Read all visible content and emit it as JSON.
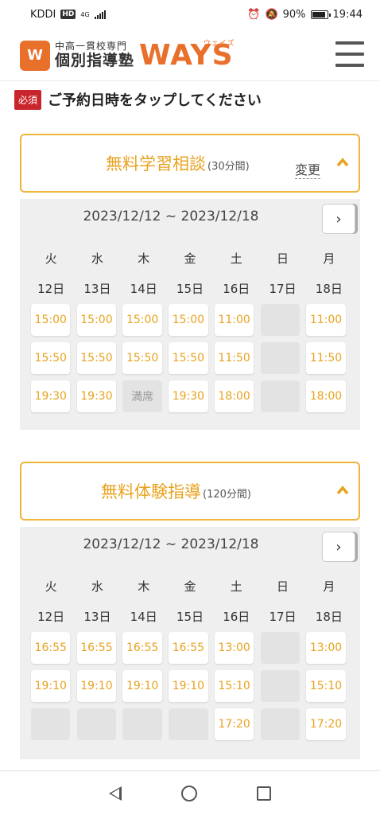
{
  "status": {
    "carrier": "KDDI",
    "hd": "HD",
    "network": "4G",
    "battery": "90%",
    "time": "19:44"
  },
  "header": {
    "logo_mark": "W",
    "logo_sub": "中高一貫校専門",
    "logo_main": "個別指導塾",
    "brand": "WAYS",
    "brand_kana": "ウェイズ"
  },
  "prompt": {
    "required": "必須",
    "text": "ご予約日時をタップしてください"
  },
  "sections": [
    {
      "title": "無料学習相談",
      "duration": "(30分間)",
      "change": "変更",
      "date_range": "2023/12/12 ~ 2023/12/18",
      "next": "›",
      "weekdays": [
        "火",
        "水",
        "木",
        "金",
        "土",
        "日",
        "月"
      ],
      "days": [
        "12日",
        "13日",
        "14日",
        "15日",
        "16日",
        "17日",
        "18日"
      ],
      "slots": [
        [
          "15:00",
          "15:00",
          "15:00",
          "15:00",
          "11:00",
          "",
          "11:00"
        ],
        [
          "15:50",
          "15:50",
          "15:50",
          "15:50",
          "11:50",
          "",
          "11:50"
        ],
        [
          "19:30",
          "19:30",
          "満席",
          "19:30",
          "18:00",
          "",
          "18:00"
        ]
      ]
    },
    {
      "title": "無料体験指導",
      "duration": "(120分間)",
      "change": "",
      "date_range": "2023/12/12 ~ 2023/12/18",
      "next": "›",
      "weekdays": [
        "火",
        "水",
        "木",
        "金",
        "土",
        "日",
        "月"
      ],
      "days": [
        "12日",
        "13日",
        "14日",
        "15日",
        "16日",
        "17日",
        "18日"
      ],
      "slots": [
        [
          "16:55",
          "16:55",
          "16:55",
          "16:55",
          "13:00",
          "",
          "13:00"
        ],
        [
          "19:10",
          "19:10",
          "19:10",
          "19:10",
          "15:10",
          "",
          "15:10"
        ],
        [
          "",
          "",
          "",
          "",
          "17:20",
          "",
          "17:20"
        ]
      ]
    }
  ],
  "colors": {
    "accent": "#e8a21e",
    "border": "#efb43a",
    "brand": "#e8702a",
    "required": "#c9252c"
  }
}
